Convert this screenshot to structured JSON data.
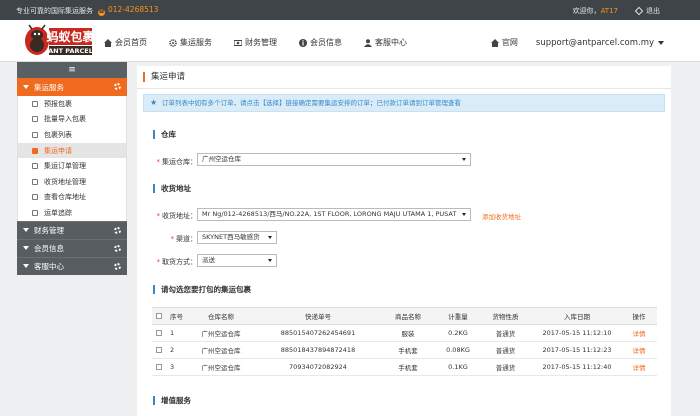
{
  "topbar": {
    "slogan": "专业可靠的国际集运服务",
    "phone": "012-4268513",
    "welcome": "欢迎你，",
    "username": "AT17",
    "logout": "退出"
  },
  "header": {
    "logo_cn": "蚂蚁包裹",
    "logo_en": "ANT PARCEL",
    "nav": [
      "会员首页",
      "集运服务",
      "财务管理",
      "会员信息",
      "客服中心"
    ],
    "home": "官网",
    "email": "support@antparcel.com.my"
  },
  "sidebar": {
    "active_section": "集运服务",
    "items": [
      "预报包裹",
      "批量导入包裹",
      "包裹列表",
      "集运申请",
      "集运订单管理",
      "收货地址管理",
      "查看仓库地址",
      "运单追踪"
    ],
    "active_item": "集运申请",
    "sections": [
      "财务管理",
      "会员信息",
      "客服中心"
    ]
  },
  "main": {
    "title": "集运申请",
    "notice": "订单列表中如有多个订单，请点击【选择】链接确定需要集运安排的订单；已付款订单请到订单管理查看",
    "warehouse_section": "仓库",
    "warehouse_label": "集运仓库：",
    "warehouse_value": "广州空运仓库",
    "address_section": "收货地址",
    "address_label": "收货地址：",
    "address_value": "Mr Ng/012-4268513/西马/NO.22A, 1ST FLOOR, LORONG MAJU UTAMA 1, PUSAT",
    "add_address": "添加收货地址",
    "channel_label": "渠道：",
    "channel_value": "SKYNET西马敏感货",
    "pickup_label": "取货方式：",
    "pickup_value": "派送",
    "packages_section": "请勾选您要打包的集运包裹",
    "table_headers": [
      "序号",
      "仓库名称",
      "快递单号",
      "商品名称",
      "计重量",
      "货物性质",
      "入库日期",
      "操作"
    ],
    "rows": [
      {
        "no": "1",
        "warehouse": "广州空运仓库",
        "tracking": "885015407262454691",
        "product": "服装",
        "weight": "0.2KG",
        "nature": "普通货",
        "date": "2017-05-15 11:12:10",
        "action": "详情"
      },
      {
        "no": "2",
        "warehouse": "广州空运仓库",
        "tracking": "885018437894872418",
        "product": "手机套",
        "weight": "0.08KG",
        "nature": "普通货",
        "date": "2017-05-15 11:12:23",
        "action": "详情"
      },
      {
        "no": "3",
        "warehouse": "广州空运仓库",
        "tracking": "70934072082924",
        "product": "手机套",
        "weight": "0.1KG",
        "nature": "普通货",
        "date": "2017-05-15 11:12:40",
        "action": "详情"
      }
    ],
    "value_added_section": "增值服务"
  },
  "colors": {
    "accent": "#f06b1f",
    "blue": "#3a87c8",
    "topbar": "#3f4449"
  }
}
